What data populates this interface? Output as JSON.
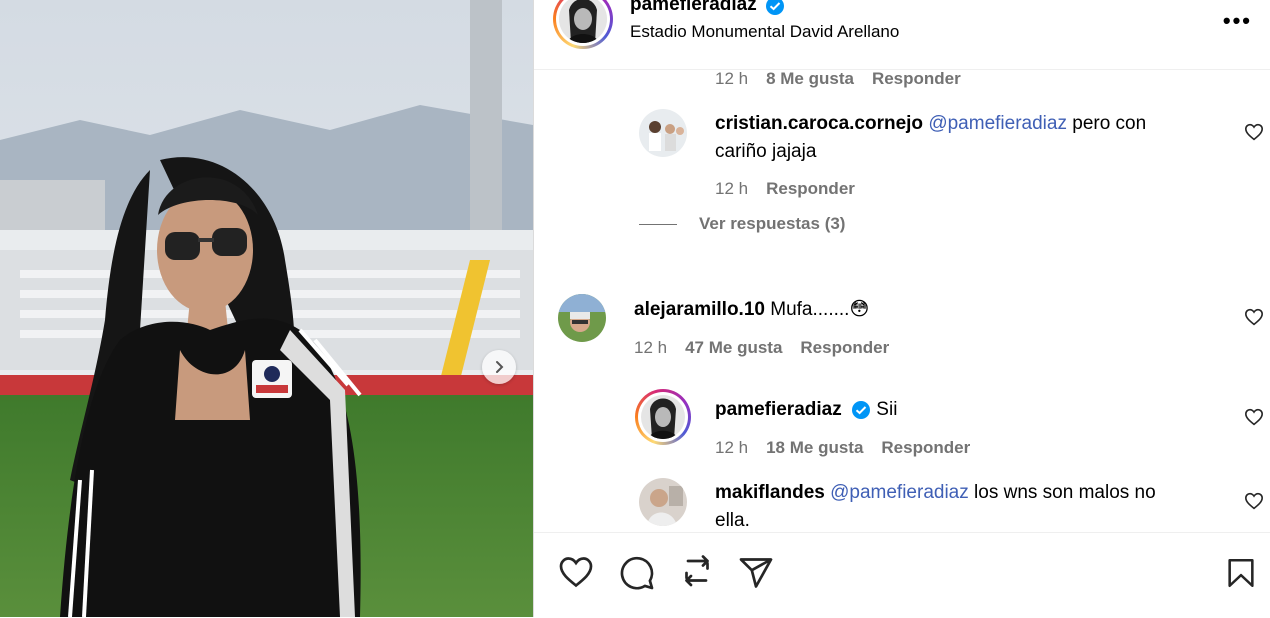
{
  "post": {
    "author": "pamefieradiaz",
    "location": "Estadio Monumental David Arellano",
    "more_label": "•••"
  },
  "comments": [
    {
      "id": "c0",
      "time": "12 h",
      "likes": "8 Me gusta",
      "reply": "Responder"
    },
    {
      "id": "c1",
      "username": "cristian.caroca.cornejo",
      "mention": "@pamefieradiaz",
      "text": " pero con cariño jajaja",
      "time": "12 h",
      "reply": "Responder"
    },
    {
      "id": "c2",
      "username": "alejaramillo.10",
      "text": "Mufa.......",
      "emoji": "😳",
      "time": "12 h",
      "likes": "47 Me gusta",
      "reply": "Responder"
    },
    {
      "id": "c3",
      "username": "pamefieradiaz",
      "text": "Sii",
      "time": "12 h",
      "likes": "18 Me gusta",
      "reply": "Responder"
    },
    {
      "id": "c4",
      "username": "makiflandes",
      "mention": "@pamefieradiaz",
      "text": " los wns son malos no ella."
    }
  ],
  "view_replies": "Ver respuestas (3)",
  "icons": {
    "heart": "heart-icon",
    "comment": "comment-icon",
    "repost": "repost-icon",
    "share": "share-icon",
    "save": "bookmark-icon",
    "verified": "verified-badge-icon",
    "next": "chevron-right-icon"
  },
  "colors": {
    "mention": "#3f5fb5",
    "verified": "#0095f6",
    "meta": "#737373"
  }
}
